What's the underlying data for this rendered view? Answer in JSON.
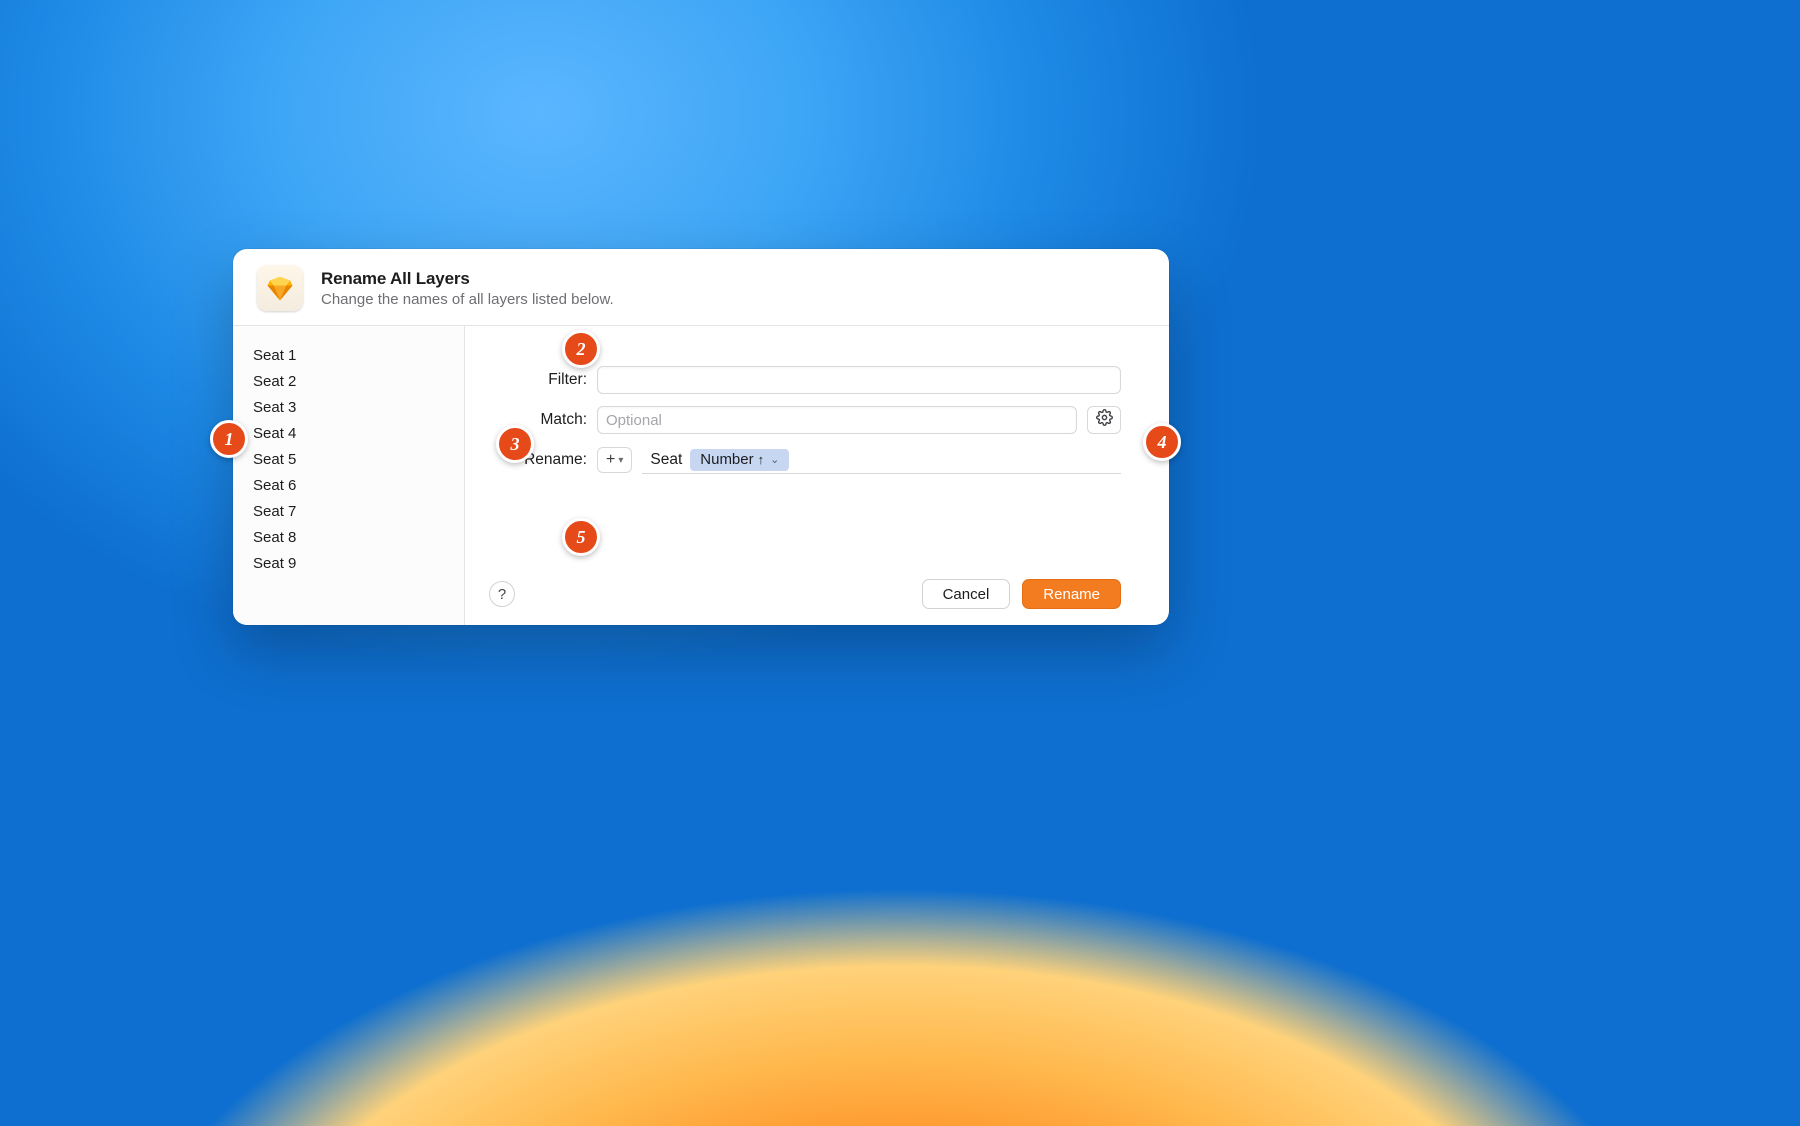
{
  "header": {
    "title": "Rename All Layers",
    "subtitle": "Change the names of all layers listed below."
  },
  "sidebar": {
    "items": [
      {
        "label": "Seat 1"
      },
      {
        "label": "Seat 2"
      },
      {
        "label": "Seat 3"
      },
      {
        "label": "Seat 4"
      },
      {
        "label": "Seat 5"
      },
      {
        "label": "Seat 6"
      },
      {
        "label": "Seat 7"
      },
      {
        "label": "Seat 8"
      },
      {
        "label": "Seat 9"
      }
    ]
  },
  "form": {
    "filter_label": "Filter:",
    "match_label": "Match:",
    "match_placeholder": "Optional",
    "rename_label": "Rename:",
    "rename_prefix": "Seat",
    "number_token": "Number",
    "number_arrow": "↑"
  },
  "buttons": {
    "plus": "+",
    "help": "?",
    "cancel": "Cancel",
    "rename": "Rename"
  },
  "markers": {
    "m1": "1",
    "m2": "2",
    "m3": "3",
    "m4": "4",
    "m5": "5"
  }
}
